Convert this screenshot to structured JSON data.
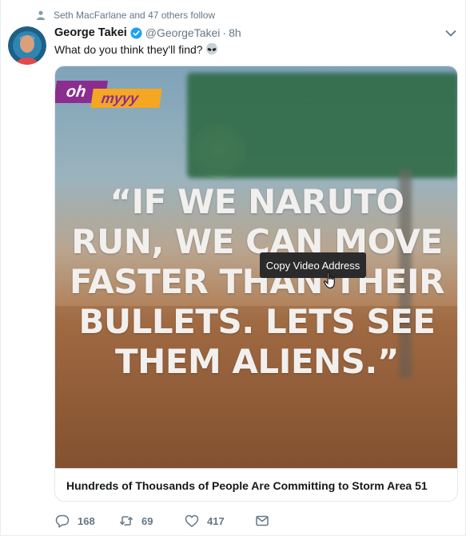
{
  "social_context": {
    "text": "Seth MacFarlane and 47 others follow"
  },
  "tweet": {
    "author_name": "George Takei",
    "handle": "@GeorgeTakei",
    "separator": "·",
    "time": "8h",
    "text": "What do you think they'll find?",
    "emoji_icon": "alien-emoji"
  },
  "media": {
    "logo_oh": "oh",
    "logo_myyy": "myyy",
    "quote_lines": [
      "“IF WE NARUTO",
      "RUN, WE CAN MOVE",
      "FASTER THAN THEIR",
      "BULLETS. LETS SEE",
      "THEM ALIENS.”"
    ],
    "tooltip": "Copy Video Address"
  },
  "card": {
    "title": "Hundreds of Thousands of People Are Committing to Storm Area 51"
  },
  "actions": {
    "replies": "168",
    "retweets": "69",
    "likes": "417"
  },
  "colors": {
    "verified": "#1da1f2",
    "muted": "#657786",
    "logo_purple": "#8b2d8f",
    "logo_orange": "#f5a623"
  }
}
